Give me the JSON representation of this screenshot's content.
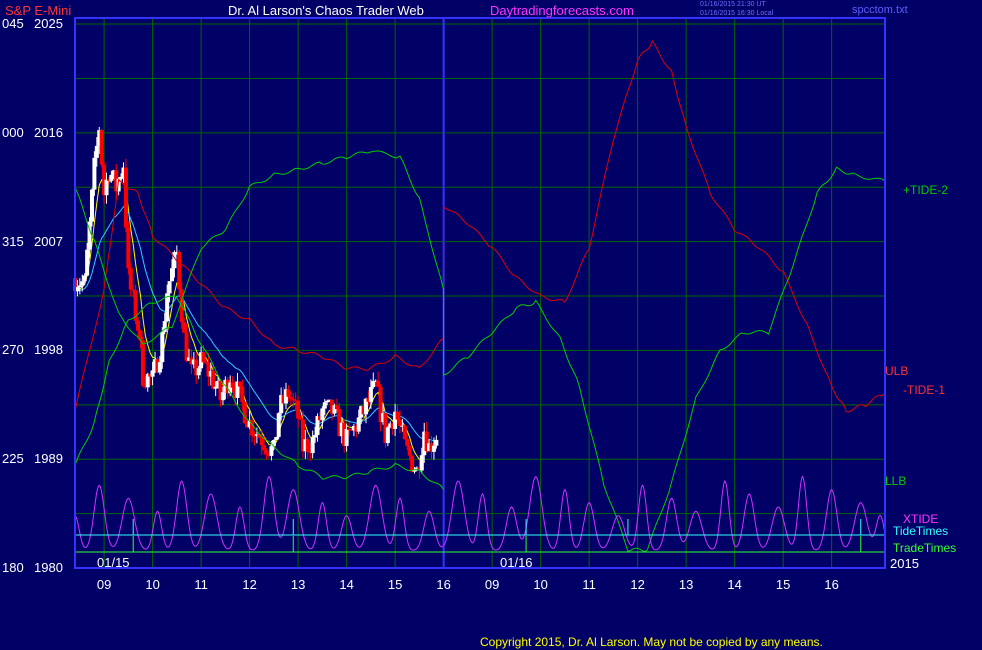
{
  "header": {
    "symbol": "S&P E-Mini",
    "title": "Dr. Al Larson's Chaos Trader Web",
    "site": "Daytradingforecasts.com",
    "time_utc": "01/16/2015 21:30 UT",
    "time_local": "01/16/2015 16:30 Local",
    "file": "spcctom.txt",
    "copyright": "Copyright 2015, Dr. Al Larson. May not be copied by any means."
  },
  "colors": {
    "background": "#000066",
    "frame": "#3333ff",
    "grid": "#006600",
    "price_up": "#ffffff",
    "price_down": "#ff0000",
    "ulb": "#dd0000",
    "llb": "#00cc00",
    "tide": "#00cc00",
    "xtide": "#cc33ff",
    "tide_times": "#33ffff",
    "trade_times": "#33ff33",
    "ma_fast": "#ffff00",
    "ma_slow": "#33ccff"
  },
  "chart_data": {
    "type": "line",
    "title": "S&P E-Mini",
    "x_ticks": [
      "09",
      "10",
      "11",
      "12",
      "13",
      "14",
      "15",
      "16",
      "09",
      "10",
      "11",
      "12",
      "13",
      "14",
      "15",
      "16"
    ],
    "date_labels": [
      "01/15",
      "01/16"
    ],
    "year_label": "2015",
    "y_ticks": [
      {
        "value": 2025,
        "prefix": "045",
        "label": "2025"
      },
      {
        "value": 2016,
        "prefix": "000",
        "label": "2016"
      },
      {
        "value": 2007,
        "prefix": "315",
        "label": "2007"
      },
      {
        "value": 1998,
        "prefix": "270",
        "label": "1998"
      },
      {
        "value": 1989,
        "prefix": "225",
        "label": "1989"
      },
      {
        "value": 1980,
        "prefix": "180",
        "label": "1980"
      }
    ],
    "ylim": [
      1980,
      2025.5
    ],
    "xlim": [
      8.4,
      25.1
    ],
    "series_labels": {
      "tide2": "+TIDE-2",
      "ulb": "ULB",
      "tide1": "-TIDE-1",
      "llb": "LLB",
      "xtide": "XTIDE",
      "tide_times": "TideTimes",
      "trade_times": "TradeTimes"
    },
    "candles_key": [
      [
        8.4,
        2004.0
      ],
      [
        8.6,
        2003.5
      ],
      [
        8.8,
        2013.0
      ],
      [
        8.9,
        2016.5
      ],
      [
        9.0,
        2011.0
      ],
      [
        9.1,
        2013.0
      ],
      [
        9.25,
        2011.5
      ],
      [
        9.4,
        2013.5
      ],
      [
        9.5,
        2004.0
      ],
      [
        9.7,
        2000.0
      ],
      [
        9.8,
        1996.0
      ],
      [
        10.0,
        1995.5
      ],
      [
        10.2,
        1999.0
      ],
      [
        10.3,
        2003.0
      ],
      [
        10.5,
        2006.0
      ],
      [
        10.65,
        1999.0
      ],
      [
        10.8,
        1996.0
      ],
      [
        11.0,
        1997.0
      ],
      [
        11.2,
        1996.0
      ],
      [
        11.4,
        1994.0
      ],
      [
        11.6,
        1996.0
      ],
      [
        11.8,
        1994.0
      ],
      [
        12.0,
        1992.0
      ],
      [
        12.3,
        1990.5
      ],
      [
        12.5,
        1989.5
      ],
      [
        12.6,
        1993.0
      ],
      [
        12.8,
        1994.5
      ],
      [
        13.0,
        1992.5
      ],
      [
        13.1,
        1990.0
      ],
      [
        13.3,
        1990.5
      ],
      [
        13.5,
        1993.0
      ],
      [
        13.7,
        1993.0
      ],
      [
        14.0,
        1990.5
      ],
      [
        14.3,
        1992.5
      ],
      [
        14.6,
        1995.0
      ],
      [
        14.8,
        1991.0
      ],
      [
        15.0,
        1993.0
      ],
      [
        15.2,
        1990.0
      ],
      [
        15.45,
        1988.0
      ],
      [
        15.6,
        1991.5
      ],
      [
        15.7,
        1990.0
      ],
      [
        15.85,
        1991.0
      ]
    ],
    "ulb": [
      [
        8.4,
        1993.0
      ],
      [
        9.0,
        2003.0
      ],
      [
        9.3,
        2012.0
      ],
      [
        9.7,
        2011.0
      ],
      [
        10.0,
        2007.5
      ],
      [
        10.5,
        2005.5
      ],
      [
        11.0,
        2003.5
      ],
      [
        11.5,
        2001.5
      ],
      [
        12.0,
        2000.5
      ],
      [
        12.5,
        1998.5
      ],
      [
        13.0,
        1998.0
      ],
      [
        13.5,
        1997.5
      ],
      [
        14.0,
        1996.5
      ],
      [
        14.5,
        1996.5
      ],
      [
        15.0,
        1997.5
      ],
      [
        15.5,
        1996.5
      ],
      [
        16.0,
        1999.0
      ],
      [
        16.0,
        2010.0
      ],
      [
        16.5,
        2008.5
      ],
      [
        17.0,
        2006.5
      ],
      [
        17.5,
        2004.0
      ],
      [
        18.0,
        2002.5
      ],
      [
        18.5,
        2002.0
      ],
      [
        19.0,
        2006.5
      ],
      [
        19.5,
        2015.5
      ],
      [
        20.0,
        2022.0
      ],
      [
        20.3,
        2023.5
      ],
      [
        20.7,
        2021.0
      ],
      [
        21.0,
        2016.5
      ],
      [
        21.5,
        2011.0
      ],
      [
        22.0,
        2008.0
      ],
      [
        22.5,
        2006.5
      ],
      [
        23.0,
        2004.5
      ],
      [
        23.5,
        2000.0
      ],
      [
        24.0,
        1995.0
      ],
      [
        24.3,
        1993.0
      ],
      [
        24.7,
        1993.5
      ],
      [
        25.1,
        1994.5
      ]
    ],
    "llb": [
      [
        8.4,
        1988.5
      ],
      [
        8.8,
        1992.0
      ],
      [
        9.1,
        1997.0
      ],
      [
        9.5,
        2000.5
      ],
      [
        10.0,
        2002.0
      ],
      [
        10.5,
        2002.5
      ],
      [
        11.0,
        1998.5
      ],
      [
        11.5,
        1995.0
      ],
      [
        12.0,
        1992.0
      ],
      [
        12.5,
        1990.0
      ],
      [
        13.0,
        1988.5
      ],
      [
        13.5,
        1987.5
      ],
      [
        14.0,
        1987.5
      ],
      [
        14.5,
        1988.0
      ],
      [
        15.0,
        1988.5
      ],
      [
        15.5,
        1988.0
      ],
      [
        16.0,
        1986.5
      ]
    ],
    "tide2": [
      [
        8.4,
        2011.5
      ],
      [
        8.8,
        2007.0
      ],
      [
        9.3,
        2001.0
      ],
      [
        9.8,
        1998.5
      ],
      [
        10.4,
        2000.0
      ],
      [
        11.0,
        2006.5
      ],
      [
        11.5,
        2008.0
      ],
      [
        12.0,
        2011.5
      ],
      [
        12.5,
        2012.5
      ],
      [
        13.0,
        2013.0
      ],
      [
        13.5,
        2013.5
      ],
      [
        14.0,
        2014.0
      ],
      [
        14.5,
        2014.5
      ],
      [
        15.1,
        2014.0
      ],
      [
        15.5,
        2010.5
      ],
      [
        16.0,
        2003.0
      ],
      [
        16.0,
        1996.0
      ],
      [
        16.5,
        1997.5
      ],
      [
        17.0,
        1999.5
      ],
      [
        17.5,
        2001.5
      ],
      [
        17.9,
        2002.0
      ],
      [
        18.4,
        1999.0
      ],
      [
        18.8,
        1995.0
      ],
      [
        19.3,
        1987.0
      ],
      [
        19.8,
        1981.5
      ],
      [
        20.2,
        1981.5
      ],
      [
        20.7,
        1987.0
      ],
      [
        21.2,
        1994.0
      ],
      [
        21.7,
        1998.0
      ],
      [
        22.2,
        1999.5
      ],
      [
        22.7,
        1999.5
      ],
      [
        23.2,
        2005.0
      ],
      [
        23.7,
        2011.0
      ],
      [
        24.1,
        2013.0
      ],
      [
        24.5,
        2012.5
      ],
      [
        25.1,
        2012.0
      ]
    ],
    "xtide_bumps": [
      8.4,
      8.9,
      9.5,
      10.1,
      10.6,
      11.2,
      11.8,
      12.4,
      12.9,
      13.5,
      14.0,
      14.6,
      15.1,
      15.7,
      16.3,
      16.8,
      17.4,
      17.9,
      18.5,
      19.0,
      19.6,
      20.1,
      20.7,
      21.2,
      21.8,
      22.3,
      22.9,
      23.4,
      24.0,
      24.6,
      25.0
    ],
    "tide_times": [
      9.6,
      12.9,
      17.7,
      19.8,
      24.6
    ],
    "trade_times": [
      9.6,
      12.9,
      17.7,
      24.6
    ]
  }
}
